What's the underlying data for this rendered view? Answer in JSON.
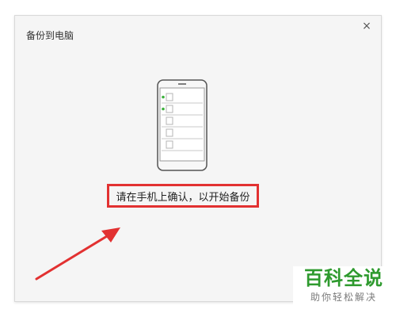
{
  "dialog": {
    "title": "备份到电脑",
    "close_label": "×"
  },
  "phone_illustration": {
    "icon": "smartphone-icon",
    "rows": [
      {
        "selected": true
      },
      {
        "selected": true
      },
      {
        "selected": false
      },
      {
        "selected": false
      },
      {
        "selected": false
      }
    ],
    "check_color": "#3cb23c"
  },
  "message": {
    "text": "请在手机上确认，以开始备份",
    "highlight_color": "#e23131"
  },
  "annotation": {
    "icon": "arrow-icon",
    "color": "#e23131"
  },
  "watermark": {
    "title": "百科全说",
    "subtitle": "助你轻松解决",
    "color": "#2e9a2e"
  }
}
